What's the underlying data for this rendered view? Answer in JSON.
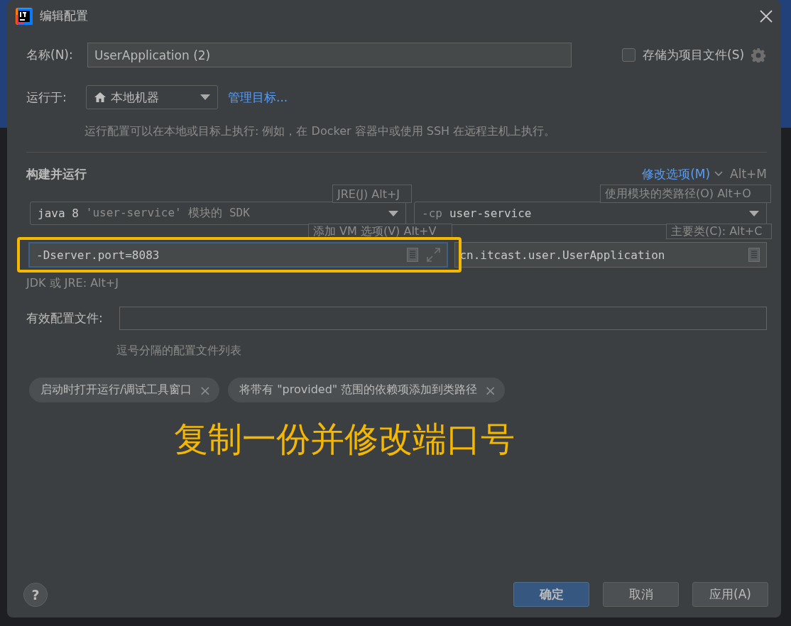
{
  "window": {
    "title": "编辑配置"
  },
  "name_field": {
    "label": "名称(N):",
    "value": "UserApplication (2)"
  },
  "store_as_project_file": {
    "label": "存储为项目文件(S)",
    "checked": false
  },
  "run_on": {
    "label": "运行于:",
    "value": "本地机器",
    "link": "管理目标...",
    "description": "运行配置可以在本地或目标上执行: 例如，在 Docker 容器中或使用 SSH 在远程主机上执行。"
  },
  "build_and_run": {
    "title": "构建并运行",
    "modify_options": "修改选项(M)",
    "modify_shortcut": "Alt+M",
    "sdk": {
      "version": "java 8",
      "hint": "'user-service' 模块的 SDK"
    },
    "classpath": {
      "flag": "-cp",
      "value": "user-service"
    },
    "vm_options": {
      "value": "-Dserver.port=8083",
      "focused": true
    },
    "main_class": {
      "value": "cn.itcast.user.UserApplication"
    },
    "jdk_hint": "JDK 或 JRE: Alt+J"
  },
  "hints": [
    {
      "text": "JRE(J) Alt+J"
    },
    {
      "text": "使用模块的类路径(O) Alt+O"
    },
    {
      "text": "添加 VM 选项(V) Alt+V"
    },
    {
      "text": "主要类(C): Alt+C"
    }
  ],
  "active_profiles": {
    "label": "有效配置文件:",
    "hint": "逗号分隔的配置文件列表"
  },
  "chips": [
    {
      "label": "启动时打开运行/调试工具窗口",
      "close": "×"
    },
    {
      "label": "将带有 \"provided\" 范围的依赖项添加到类路径",
      "close": "×"
    }
  ],
  "help": "?",
  "buttons": [
    {
      "label": "确定",
      "default": true
    },
    {
      "label": "取消",
      "default": false
    },
    {
      "label": "应用(A)",
      "default": false
    }
  ],
  "annotation": {
    "text": "复制一份并修改端口号"
  }
}
